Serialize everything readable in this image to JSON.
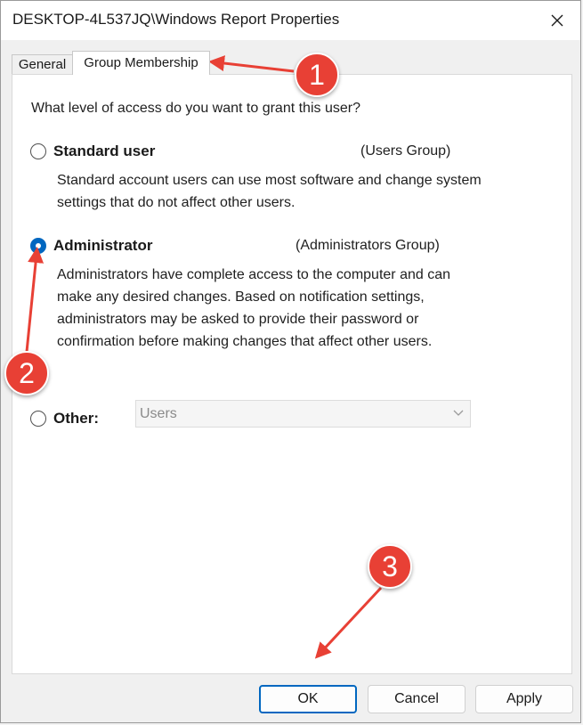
{
  "window": {
    "title": "DESKTOP-4L537JQ\\Windows Report Properties"
  },
  "tabs": [
    {
      "label": "General",
      "active": false
    },
    {
      "label": "Group Membership",
      "active": true
    }
  ],
  "panel": {
    "question": "What level of access do you want to grant this user?",
    "options": [
      {
        "label": "Standard user",
        "group": "(Users Group)",
        "checked": false,
        "description": "Standard account users can use most software and change system settings that do not affect other users."
      },
      {
        "label": "Administrator",
        "group": "(Administrators Group)",
        "checked": true,
        "description": "Administrators have complete access to the computer and can make any desired changes. Based on notification settings, administrators may be asked to provide their password or confirmation before making changes that affect other users."
      },
      {
        "label": "Other:",
        "checked": false,
        "dropdown_value": "Users"
      }
    ]
  },
  "buttons": {
    "ok": "OK",
    "cancel": "Cancel",
    "apply": "Apply"
  },
  "annotations": [
    "1",
    "2",
    "3"
  ],
  "colors": {
    "accent": "#0067c0",
    "callout": "#e84035"
  }
}
